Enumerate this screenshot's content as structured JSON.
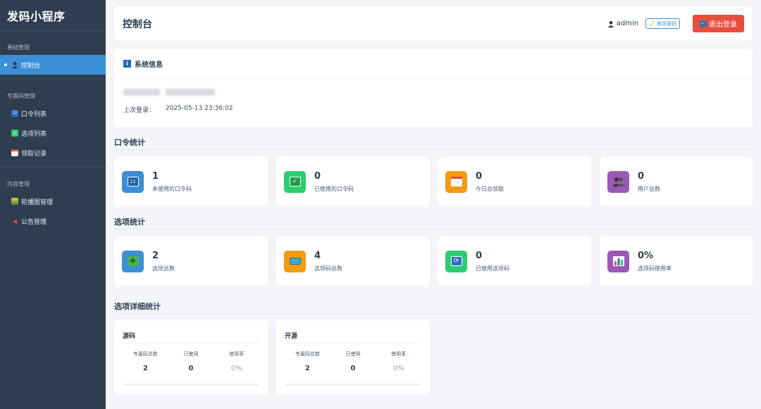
{
  "sidebar": {
    "brand": "发码小程序",
    "sections": [
      {
        "title": "基础管理",
        "items": [
          {
            "label": "控制台",
            "icon": "user-icon",
            "active": true
          }
        ]
      },
      {
        "title": "专属码管理",
        "items": [
          {
            "label": "口令列表",
            "icon": "numbers-icon"
          },
          {
            "label": "选项列表",
            "icon": "checkbox-icon"
          },
          {
            "label": "领取记录",
            "icon": "calendar-icon"
          }
        ]
      },
      {
        "title": "内容管理",
        "items": [
          {
            "label": "轮播图管理",
            "icon": "picture-icon"
          },
          {
            "label": "公告管理",
            "icon": "megaphone-icon"
          }
        ]
      }
    ]
  },
  "header": {
    "title": "控制台",
    "username": "admin",
    "change_password": "修改密码",
    "logout": "退出登录"
  },
  "sysinfo": {
    "title": "系统信息",
    "last_login_label": "上次登录：",
    "last_login_value": "2025-05-13 23:36:02"
  },
  "code_stats": {
    "title": "口令统计",
    "cards": [
      {
        "value": "1",
        "label": "未使用的口令码",
        "icon": "numbers-icon",
        "color": "#3a8fd6"
      },
      {
        "value": "0",
        "label": "已使用的口令码",
        "icon": "checkbox-icon",
        "color": "#2ecc71"
      },
      {
        "value": "0",
        "label": "今日总领取",
        "icon": "calendar-icon",
        "color": "#f39c12"
      },
      {
        "value": "0",
        "label": "用户总数",
        "icon": "users-icon",
        "color": "#9b59b6"
      }
    ]
  },
  "option_stats": {
    "title": "选项统计",
    "cards": [
      {
        "value": "2",
        "label": "选项总数",
        "icon": "puzzle-icon",
        "color": "#3a8fd6"
      },
      {
        "value": "4",
        "label": "选项码总数",
        "icon": "ticket-icon",
        "color": "#f39c12"
      },
      {
        "value": "0",
        "label": "已使用选项码",
        "icon": "refresh-icon",
        "color": "#2ecc71"
      },
      {
        "value": "0%",
        "label": "选项码使用率",
        "icon": "bar-chart-icon",
        "color": "#9b59b6"
      }
    ]
  },
  "detail_stats": {
    "title": "选项详细统计",
    "col_total": "专属码总数",
    "col_used": "已使用",
    "col_rate": "使用率",
    "items": [
      {
        "name": "源码",
        "total": "2",
        "used": "0",
        "rate": "0%"
      },
      {
        "name": "开源",
        "total": "2",
        "used": "0",
        "rate": "0%"
      }
    ]
  }
}
